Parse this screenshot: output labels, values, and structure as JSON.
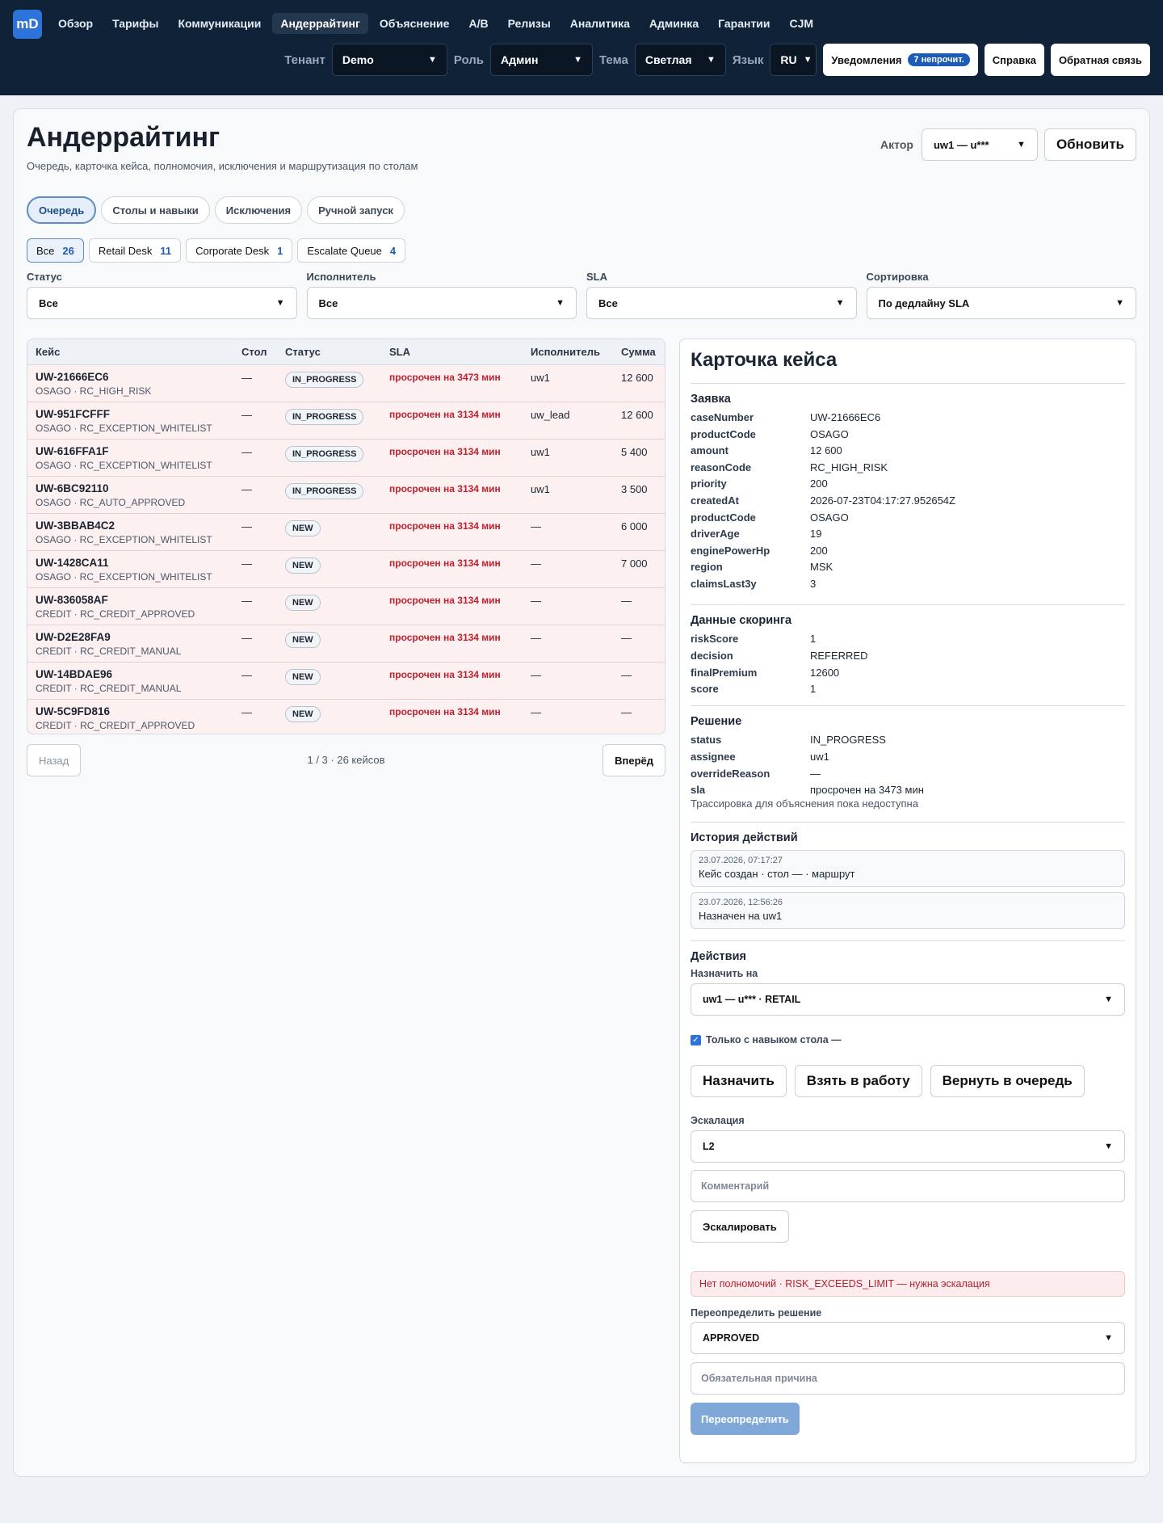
{
  "app": {
    "logo": "mD",
    "nav": [
      "Обзор",
      "Тарифы",
      "Коммуникации",
      "Андеррайтинг",
      "Объяснение",
      "A/B",
      "Релизы",
      "Аналитика",
      "Админка",
      "Гарантии",
      "CJM"
    ],
    "active_nav": "Андеррайтинг"
  },
  "header": {
    "tenant_label": "Тенант",
    "tenant_value": "Demo",
    "role_label": "Роль",
    "role_value": "Админ",
    "theme_label": "Тема",
    "theme_value": "Светлая",
    "lang_label": "Язык",
    "lang_value": "RU",
    "notifications_label": "Уведомления",
    "notifications_badge": "7 непрочит.",
    "help_label": "Справка",
    "feedback_label": "Обратная связь"
  },
  "page": {
    "title": "Андеррайтинг",
    "subtitle": "Очередь, карточка кейса, полномочия, исключения и маршрутизация по столам",
    "actor_label": "Актор",
    "actor_value": "uw1 — u***",
    "refresh_label": "Обновить"
  },
  "tabs": [
    "Очередь",
    "Столы и навыки",
    "Исключения",
    "Ручной запуск"
  ],
  "desks": [
    {
      "name": "Все",
      "count": "26"
    },
    {
      "name": "Retail Desk",
      "count": "11"
    },
    {
      "name": "Corporate Desk",
      "count": "1"
    },
    {
      "name": "Escalate Queue",
      "count": "4"
    }
  ],
  "filters": [
    {
      "label": "Статус",
      "value": "Все"
    },
    {
      "label": "Исполнитель",
      "value": "Все"
    },
    {
      "label": "SLA",
      "value": "Все"
    },
    {
      "label": "Сортировка",
      "value": "По дедлайну SLA"
    }
  ],
  "table": {
    "headers": [
      "Кейс",
      "Стол",
      "Статус",
      "SLA",
      "Исполнитель",
      "Сумма"
    ],
    "rows": [
      {
        "id": "UW-21666EC6",
        "sub": "OSAGO · RC_HIGH_RISK",
        "desk": "—",
        "status": "IN_PROGRESS",
        "sla": "просрочен на 3473 мин",
        "exec": "uw1",
        "sum": "12 600"
      },
      {
        "id": "UW-951FCFFF",
        "sub": "OSAGO · RC_EXCEPTION_WHITELIST",
        "desk": "—",
        "status": "IN_PROGRESS",
        "sla": "просрочен на 3134 мин",
        "exec": "uw_lead",
        "sum": "12 600"
      },
      {
        "id": "UW-616FFA1F",
        "sub": "OSAGO · RC_EXCEPTION_WHITELIST",
        "desk": "—",
        "status": "IN_PROGRESS",
        "sla": "просрочен на 3134 мин",
        "exec": "uw1",
        "sum": "5 400"
      },
      {
        "id": "UW-6BC92110",
        "sub": "OSAGO · RC_AUTO_APPROVED",
        "desk": "—",
        "status": "IN_PROGRESS",
        "sla": "просрочен на 3134 мин",
        "exec": "uw1",
        "sum": "3 500"
      },
      {
        "id": "UW-3BBAB4C2",
        "sub": "OSAGO · RC_EXCEPTION_WHITELIST",
        "desk": "—",
        "status": "NEW",
        "sla": "просрочен на 3134 мин",
        "exec": "—",
        "sum": "6 000"
      },
      {
        "id": "UW-1428CA11",
        "sub": "OSAGO · RC_EXCEPTION_WHITELIST",
        "desk": "—",
        "status": "NEW",
        "sla": "просрочен на 3134 мин",
        "exec": "—",
        "sum": "7 000"
      },
      {
        "id": "UW-836058AF",
        "sub": "CREDIT · RC_CREDIT_APPROVED",
        "desk": "—",
        "status": "NEW",
        "sla": "просрочен на 3134 мин",
        "exec": "—",
        "sum": "—"
      },
      {
        "id": "UW-D2E28FA9",
        "sub": "CREDIT · RC_CREDIT_MANUAL",
        "desk": "—",
        "status": "NEW",
        "sla": "просрочен на 3134 мин",
        "exec": "—",
        "sum": "—"
      },
      {
        "id": "UW-14BDAE96",
        "sub": "CREDIT · RC_CREDIT_MANUAL",
        "desk": "—",
        "status": "NEW",
        "sla": "просрочен на 3134 мин",
        "exec": "—",
        "sum": "—"
      },
      {
        "id": "UW-5C9FD816",
        "sub": "CREDIT · RC_CREDIT_APPROVED",
        "desk": "—",
        "status": "NEW",
        "sla": "просрочен на 3134 мин",
        "exec": "—",
        "sum": "—"
      }
    ]
  },
  "pager": {
    "prev": "Назад",
    "info": "1 / 3 · 26 кейсов",
    "next": "Вперёд"
  },
  "case_card": {
    "title": "Карточка кейса",
    "application_title": "Заявка",
    "application": [
      [
        "caseNumber",
        "UW-21666EC6"
      ],
      [
        "productCode",
        "OSAGO"
      ],
      [
        "amount",
        "12 600"
      ],
      [
        "reasonCode",
        "RC_HIGH_RISK"
      ],
      [
        "priority",
        "200"
      ],
      [
        "createdAt",
        "2026-07-23T04:17:27.952654Z"
      ],
      [
        "productCode",
        "OSAGO"
      ],
      [
        "driverAge",
        "19"
      ],
      [
        "enginePowerHp",
        "200"
      ],
      [
        "region",
        "MSK"
      ],
      [
        "claimsLast3y",
        "3"
      ]
    ],
    "scoring_title": "Данные скоринга",
    "scoring": [
      [
        "riskScore",
        "1"
      ],
      [
        "decision",
        "REFERRED"
      ],
      [
        "finalPremium",
        "12600"
      ],
      [
        "score",
        "1"
      ]
    ],
    "decision_title": "Решение",
    "decision": [
      [
        "status",
        "IN_PROGRESS"
      ],
      [
        "assignee",
        "uw1"
      ],
      [
        "overrideReason",
        "—"
      ],
      [
        "sla",
        "просрочен на 3473 мин"
      ]
    ],
    "trace_note": "Трассировка для объяснения пока недоступна",
    "history_title": "История действий",
    "history": [
      {
        "ts": "23.07.2026, 07:17:27",
        "text": "Кейс создан · стол — · маршрут"
      },
      {
        "ts": "23.07.2026, 12:56:26",
        "text": "Назначен на uw1"
      }
    ],
    "actions_title": "Действия",
    "assign_label": "Назначить на",
    "assign_value": "uw1 — u*** · RETAIL",
    "skill_only_label": "Только с навыком стола —",
    "assign_btn": "Назначить",
    "take_btn": "Взять в работу",
    "return_btn": "Вернуть в очередь",
    "escalation_label": "Эскалация",
    "escalation_value": "L2",
    "comment_placeholder": "Комментарий",
    "escalate_btn": "Эскалировать",
    "alert": "Нет полномочий · RISK_EXCEEDS_LIMIT — нужна эскалация",
    "override_label": "Переопределить решение",
    "override_value": "APPROVED",
    "reason_placeholder": "Обязательная причина",
    "override_btn": "Переопределить"
  }
}
